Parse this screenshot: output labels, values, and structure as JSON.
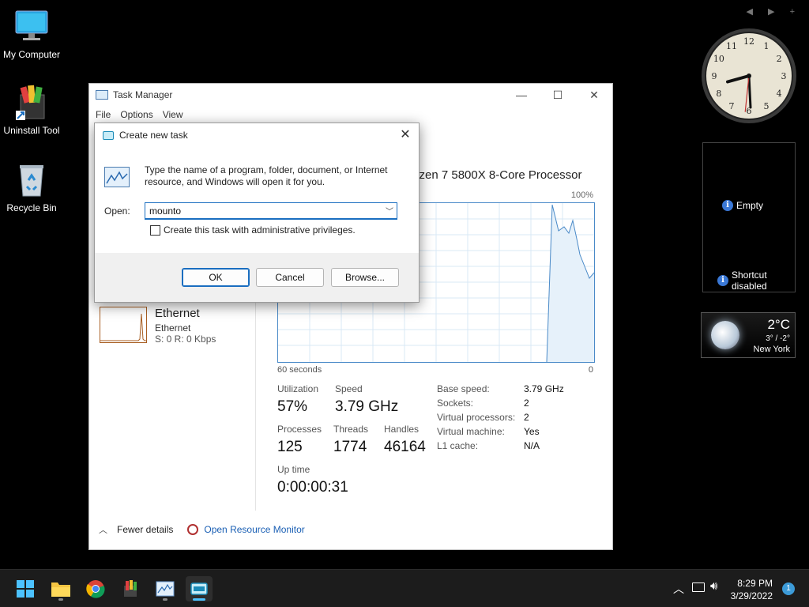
{
  "desktop": {
    "icons": [
      {
        "label": "My Computer"
      },
      {
        "label": "Uninstall Tool"
      },
      {
        "label": "Recycle Bin"
      }
    ]
  },
  "gadgets": {
    "clock": {
      "hour": 8,
      "minute": 29,
      "second": 31
    },
    "slideshow": {
      "empty_label": "Empty",
      "shortcut_line1": "Shortcut",
      "shortcut_line2": "disabled"
    },
    "weather": {
      "temp": "2°C",
      "range": "3° / -2°",
      "city": "New York"
    }
  },
  "task_manager": {
    "title": "Task Manager",
    "menu": [
      "File",
      "Options",
      "View"
    ],
    "cpu_title": "yzen 7 5800X 8-Core Processor",
    "graph": {
      "max_label": "100%",
      "left_label": "60 seconds",
      "right_label": "0"
    },
    "ethernet": {
      "name": "Ethernet",
      "adapter": "Ethernet",
      "rate": "S: 0 R: 0 Kbps"
    },
    "stats": {
      "utilization_label": "Utilization",
      "utilization": "57%",
      "speed_label": "Speed",
      "speed": "3.79 GHz",
      "processes_label": "Processes",
      "processes": "125",
      "threads_label": "Threads",
      "threads": "1774",
      "handles_label": "Handles",
      "handles": "46164",
      "uptime_label": "Up time",
      "uptime": "0:00:00:31"
    },
    "details": [
      {
        "k": "Base speed:",
        "v": "3.79 GHz"
      },
      {
        "k": "Sockets:",
        "v": "2"
      },
      {
        "k": "Virtual processors:",
        "v": "2"
      },
      {
        "k": "Virtual machine:",
        "v": "Yes"
      },
      {
        "k": "L1 cache:",
        "v": "N/A"
      }
    ],
    "footer": {
      "fewer": "Fewer details",
      "resmon": "Open Resource Monitor"
    }
  },
  "dialog": {
    "title": "Create new task",
    "description": "Type the name of a program, folder, document, or Internet resource, and Windows will open it for you.",
    "open_label": "Open:",
    "open_value": "mounto",
    "admin_label": "Create this task with administrative privileges.",
    "ok": "OK",
    "cancel": "Cancel",
    "browse": "Browse..."
  },
  "taskbar": {
    "time": "8:29 PM",
    "date": "3/29/2022",
    "notification_count": "1"
  },
  "colors": {
    "accent": "#1a6ec0",
    "graph_line": "#4a8ac8",
    "taskbar": "#1c1c1c"
  }
}
